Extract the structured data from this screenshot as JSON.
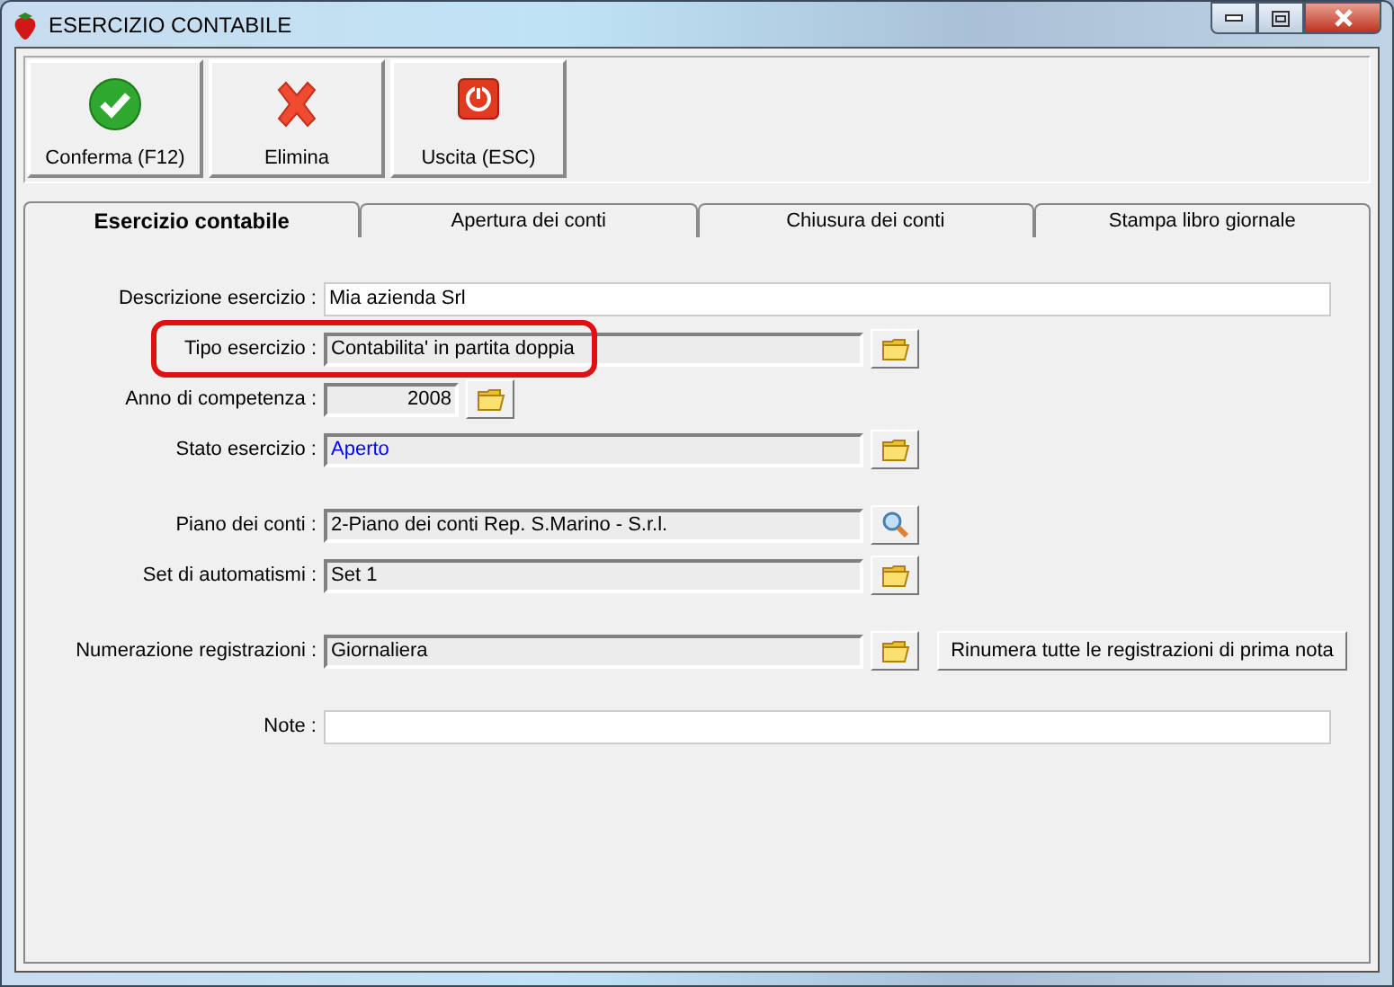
{
  "window": {
    "title": "ESERCIZIO CONTABILE"
  },
  "toolbar": [
    {
      "label": "Conferma (F12)",
      "kind": "check"
    },
    {
      "label": "Elimina",
      "kind": "cross"
    },
    {
      "label": "Uscita (ESC)",
      "kind": "power"
    }
  ],
  "tabs": [
    {
      "label": "Esercizio contabile",
      "selected": true
    },
    {
      "label": "Apertura dei conti",
      "selected": false
    },
    {
      "label": "Chiusura dei conti",
      "selected": false
    },
    {
      "label": "Stampa libro giornale",
      "selected": false
    }
  ],
  "sections": [
    [
      {
        "label": "Descrizione esercizio :",
        "value": "Mia azienda Srl",
        "kind": "text",
        "highlighted": false
      },
      {
        "label": "Tipo esercizio :",
        "value": "Contabilita' in partita doppia",
        "kind": "readonly",
        "button": {
          "kind": "folder"
        },
        "highlighted": true
      },
      {
        "label": "Anno di competenza :",
        "value": "2008",
        "kind": "number",
        "button": {
          "kind": "folder"
        },
        "highlighted": false
      },
      {
        "label": "Stato esercizio :",
        "value": "Aperto",
        "kind": "readonly",
        "button": {
          "kind": "folder"
        },
        "color": "#0000ff",
        "highlighted": false
      }
    ],
    [
      {
        "label": "Piano dei conti :",
        "value": "2-Piano dei conti Rep. S.Marino - S.r.l.",
        "kind": "readonly",
        "button": {
          "kind": "search"
        },
        "highlighted": false
      },
      {
        "label": "Set di automatismi :",
        "value": "Set 1",
        "kind": "readonly",
        "button": {
          "kind": "folder"
        },
        "highlighted": false
      }
    ],
    [
      {
        "label": "Numerazione registrazioni :",
        "value": "Giornaliera",
        "kind": "readonly",
        "button": {
          "kind": "folder"
        },
        "action": "Rinumera tutte le registrazioni di prima nota",
        "highlighted": false
      }
    ],
    [
      {
        "label": "Note :",
        "kind": "text",
        "highlighted": false
      }
    ]
  ]
}
